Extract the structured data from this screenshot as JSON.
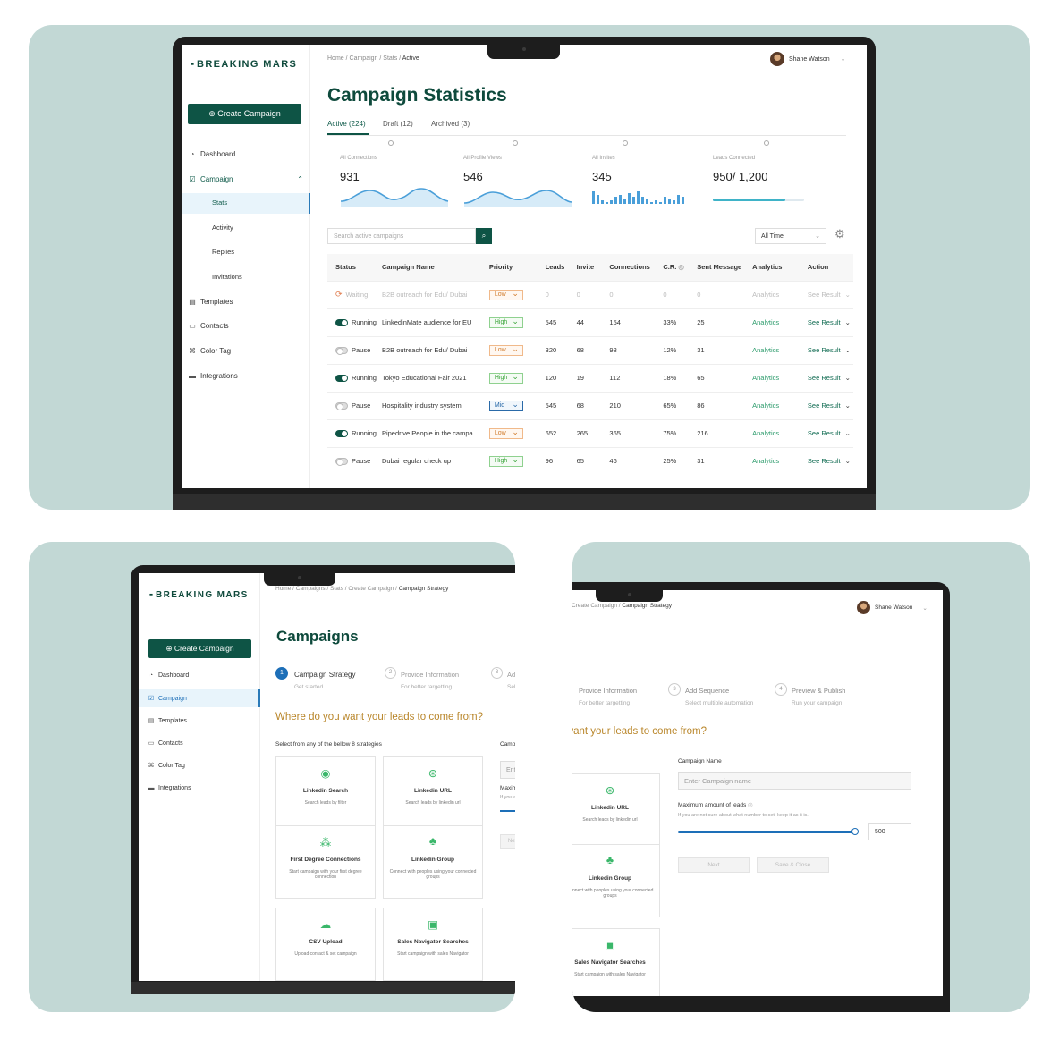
{
  "brand": "BREAKING MARS",
  "user_name": "Shane Watson",
  "create_campaign": "Create Campaign",
  "nav": {
    "dashboard": "Dashboard",
    "campaign": "Campaign",
    "stats": "Stats",
    "activity": "Activity",
    "replies": "Replies",
    "invitations": "Invitations",
    "templates": "Templates",
    "contacts": "Contacts",
    "color_tag": "Color Tag",
    "integrations": "Integrations"
  },
  "stats_screen": {
    "breadcrumb": [
      "Home",
      "Campaign",
      "Stats",
      "Active"
    ],
    "title": "Campaign Statistics",
    "tabs": [
      "Active (224)",
      "Draft (12)",
      "Archived (3)"
    ],
    "stats": [
      {
        "label": "All Connections",
        "value": "931"
      },
      {
        "label": "All Profile Views",
        "value": "546"
      },
      {
        "label": "All Invites",
        "value": "345"
      },
      {
        "label": "Leads Connected",
        "value": "950/ 1,200",
        "progress": 0.79
      }
    ],
    "search_placeholder": "Search active campaigns",
    "time_filter": "All Time",
    "columns": [
      "Status",
      "Campaign Name",
      "Priority",
      "Leads",
      "Invite",
      "Connections",
      "C.R.",
      "Sent Message",
      "Analytics",
      "Action"
    ],
    "rows": [
      {
        "status": "Waiting",
        "name": "B2B outreach for Edu/ Dubai",
        "priority": "Low",
        "leads": "0",
        "invite": "0",
        "connections": "0",
        "cr": "0",
        "sent": "0",
        "analytics": "Analytics",
        "action": "See Result"
      },
      {
        "status": "Running",
        "name": "LinkedinMate audience for EU",
        "priority": "High",
        "leads": "545",
        "invite": "44",
        "connections": "154",
        "cr": "33%",
        "sent": "25",
        "analytics": "Analytics",
        "action": "See Result"
      },
      {
        "status": "Pause",
        "name": "B2B outreach for Edu/ Dubai",
        "priority": "Low",
        "leads": "320",
        "invite": "68",
        "connections": "98",
        "cr": "12%",
        "sent": "31",
        "analytics": "Analytics",
        "action": "See Result"
      },
      {
        "status": "Running",
        "name": "Tokyo Educational Fair 2021",
        "priority": "High",
        "leads": "120",
        "invite": "19",
        "connections": "112",
        "cr": "18%",
        "sent": "65",
        "analytics": "Analytics",
        "action": "See Result"
      },
      {
        "status": "Pause",
        "name": "Hospitality industry system",
        "priority": "Mid",
        "leads": "545",
        "invite": "68",
        "connections": "210",
        "cr": "65%",
        "sent": "86",
        "analytics": "Analytics",
        "action": "See Result"
      },
      {
        "status": "Running",
        "name": "Pipedrive People in the campa...",
        "priority": "Low",
        "leads": "652",
        "invite": "265",
        "connections": "365",
        "cr": "75%",
        "sent": "216",
        "analytics": "Analytics",
        "action": "See Result"
      },
      {
        "status": "Pause",
        "name": "Dubai regular check up",
        "priority": "High",
        "leads": "96",
        "invite": "65",
        "connections": "46",
        "cr": "25%",
        "sent": "31",
        "analytics": "Analytics",
        "action": "See Result"
      }
    ]
  },
  "campaign_screen": {
    "breadcrumb": [
      "Home",
      "Campaigns",
      "Stats",
      "Create Campaign",
      "Campaign Strategy"
    ],
    "title": "Campaigns",
    "steps": [
      {
        "num": "1",
        "title": "Campaign Strategy",
        "sub": "Get started"
      },
      {
        "num": "2",
        "title": "Provide Information",
        "sub": "For better targetting"
      },
      {
        "num": "3",
        "title": "Add Sequence",
        "sub": "Select multiple automation"
      },
      {
        "num": "4",
        "title": "Preview & Publish",
        "sub": "Run your campaign"
      }
    ],
    "question": "Where do you want your leads to come from?",
    "select_hint": "Select from any of the bellow 8 strategies",
    "cards": [
      {
        "icon": "globe-search-icon",
        "title": "Linkedin Search",
        "desc": "Search leads by filter"
      },
      {
        "icon": "link-globe-icon",
        "title": "Linkedin URL",
        "desc": "Search leads by linkedin url"
      },
      {
        "icon": "connections-icon",
        "title": "First Degree Connections",
        "desc": "Start campaign with your first degree connection"
      },
      {
        "icon": "group-icon",
        "title": "Linkedin Group",
        "desc": "Connect with peoples using your connected groups"
      },
      {
        "icon": "cloud-upload-icon",
        "title": "CSV Upload",
        "desc": "Upload contact & set campaign"
      },
      {
        "icon": "navigator-icon",
        "title": "Sales Navigator Searches",
        "desc": "Start campaign with sales Navigator"
      }
    ],
    "campaign_name_label": "Campaign Name",
    "campaign_name_placeholder": "Enter Campaign name",
    "max_leads_label": "Maximum amount of leads",
    "max_leads_hint": "If you are not sure about what number to set, keep it as it is.",
    "max_leads_value": "500",
    "max_leads_fraction": 1.0,
    "next_label": "Next",
    "save_close_label": "Save & Close"
  },
  "colors": {
    "brand_green": "#0e5445",
    "accent_blue": "#1d6fb8",
    "question_gold": "#b9862a",
    "panel_bg": "#c2d8d5"
  }
}
